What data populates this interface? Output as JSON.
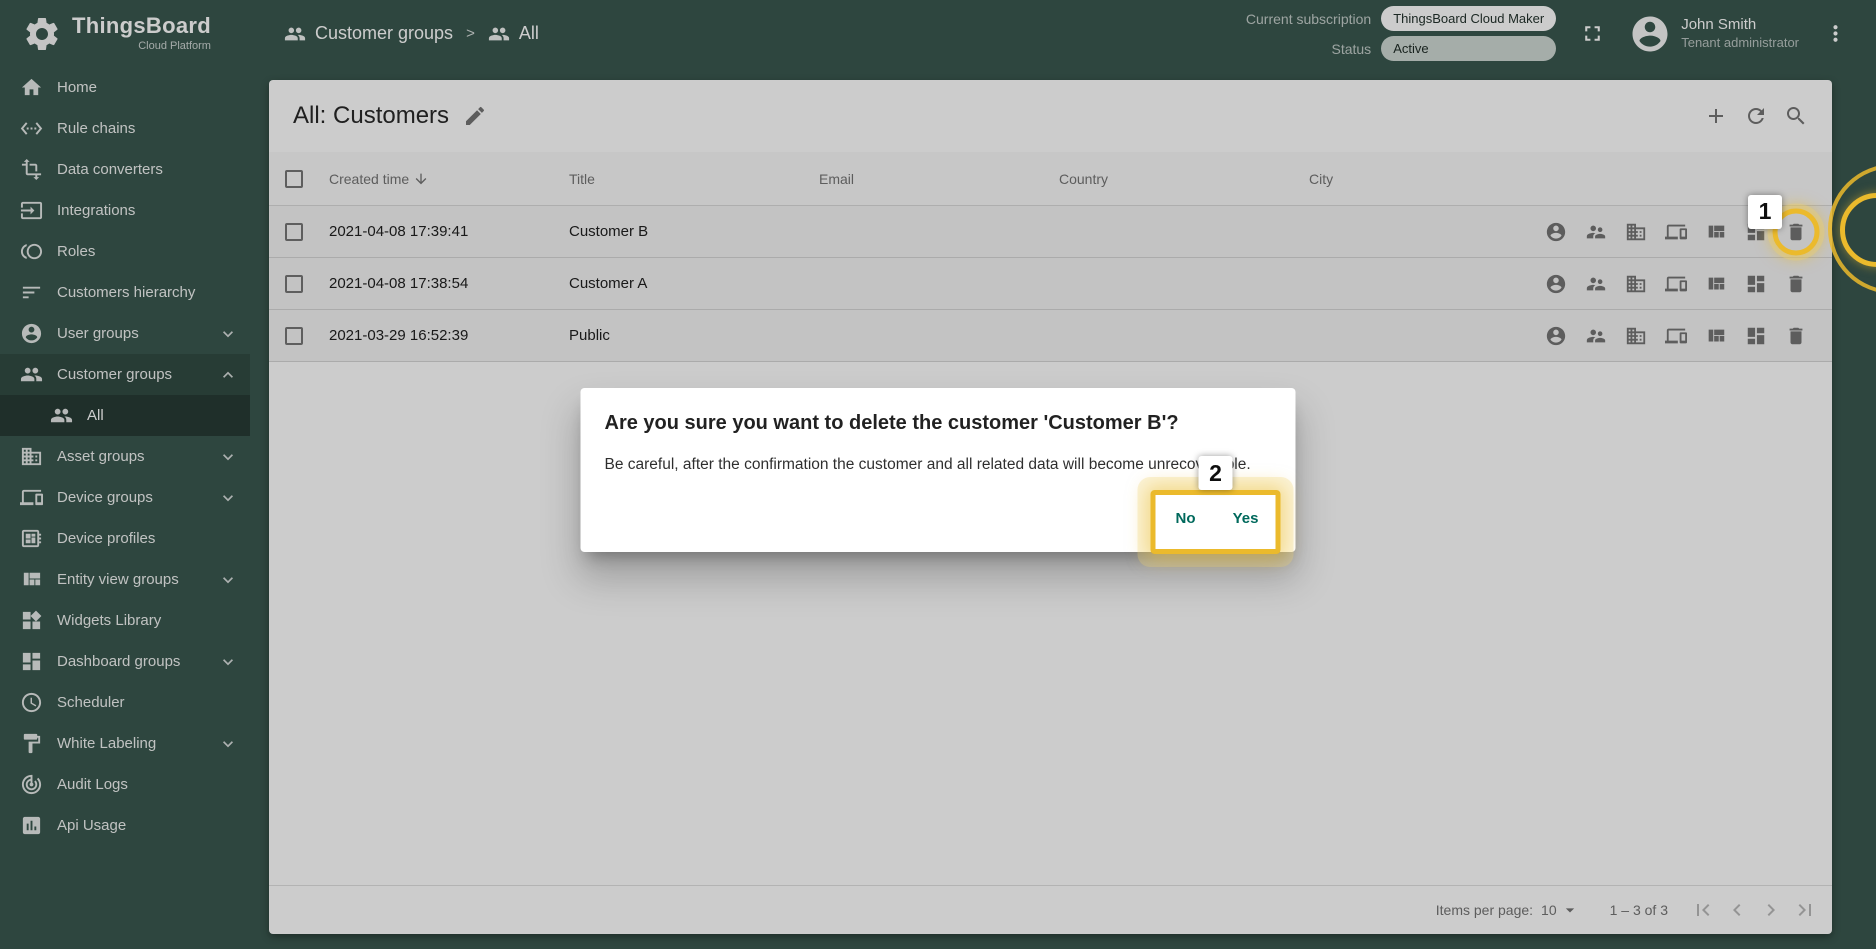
{
  "brand": {
    "name": "ThingsBoard",
    "tagline": "Cloud Platform",
    "logo_icon": "logo-gear-icon"
  },
  "header": {
    "breadcrumb": [
      {
        "label": "Customer groups",
        "icon": "customer-groups-icon"
      },
      {
        "label": "All",
        "icon": "people-icon"
      }
    ],
    "separator": ">",
    "subscription": {
      "label": "Current subscription",
      "value": "ThingsBoard Cloud Maker"
    },
    "status": {
      "label": "Status",
      "value": "Active"
    },
    "user": {
      "name": "John Smith",
      "role": "Tenant administrator"
    }
  },
  "sidebar": {
    "items": [
      {
        "label": "Home",
        "icon": "home-icon"
      },
      {
        "label": "Rule chains",
        "icon": "rule-chains-icon"
      },
      {
        "label": "Data converters",
        "icon": "data-converters-icon"
      },
      {
        "label": "Integrations",
        "icon": "integrations-icon"
      },
      {
        "label": "Roles",
        "icon": "roles-icon"
      },
      {
        "label": "Customers hierarchy",
        "icon": "customers-hierarchy-icon"
      },
      {
        "label": "User groups",
        "icon": "user-groups-icon",
        "expandable": true,
        "expanded": false
      },
      {
        "label": "Customer groups",
        "icon": "customer-groups-icon",
        "expandable": true,
        "expanded": true,
        "section": true
      },
      {
        "label": "All",
        "icon": "people-icon",
        "child": true,
        "section": true,
        "active": true
      },
      {
        "label": "Asset groups",
        "icon": "asset-groups-icon",
        "expandable": true,
        "expanded": false
      },
      {
        "label": "Device groups",
        "icon": "device-groups-icon",
        "expandable": true,
        "expanded": false
      },
      {
        "label": "Device profiles",
        "icon": "device-profiles-icon"
      },
      {
        "label": "Entity view groups",
        "icon": "entity-view-groups-icon",
        "expandable": true,
        "expanded": false
      },
      {
        "label": "Widgets Library",
        "icon": "widgets-icon"
      },
      {
        "label": "Dashboard groups",
        "icon": "dashboard-groups-icon",
        "expandable": true,
        "expanded": false
      },
      {
        "label": "Scheduler",
        "icon": "scheduler-icon"
      },
      {
        "label": "White Labeling",
        "icon": "white-labeling-icon",
        "expandable": true,
        "expanded": false
      },
      {
        "label": "Audit Logs",
        "icon": "audit-logs-icon"
      },
      {
        "label": "Api Usage",
        "icon": "api-usage-icon"
      }
    ]
  },
  "page": {
    "title": "All: Customers"
  },
  "table": {
    "columns": [
      {
        "label": "Created time",
        "sort": "desc"
      },
      {
        "label": "Title"
      },
      {
        "label": "Email"
      },
      {
        "label": "Country"
      },
      {
        "label": "City"
      }
    ],
    "rows": [
      {
        "created_time": "2021-04-08 17:39:41",
        "title": "Customer B",
        "email": "",
        "country": "",
        "city": ""
      },
      {
        "created_time": "2021-04-08 17:38:54",
        "title": "Customer A",
        "email": "",
        "country": "",
        "city": ""
      },
      {
        "created_time": "2021-03-29 16:52:39",
        "title": "Public",
        "email": "",
        "country": "",
        "city": ""
      }
    ],
    "row_actions": [
      {
        "name": "manage-users",
        "icon": "account-circle-icon"
      },
      {
        "name": "manage-user-groups",
        "icon": "supervisor-account-icon"
      },
      {
        "name": "manage-asset-groups",
        "icon": "asset-groups-icon"
      },
      {
        "name": "manage-device-groups",
        "icon": "device-groups-icon"
      },
      {
        "name": "manage-entity-view-groups",
        "icon": "entity-view-groups-icon"
      },
      {
        "name": "manage-dashboard-groups",
        "icon": "dashboard-groups-icon"
      },
      {
        "name": "delete",
        "icon": "delete-icon"
      }
    ]
  },
  "paginator": {
    "items_per_page_label": "Items per page:",
    "items_per_page": "10",
    "range": "1 – 3 of 3"
  },
  "dialog": {
    "title": "Are you sure you want to delete the customer 'Customer B'?",
    "message": "Be careful, after the confirmation the customer and all related data will become unrecoverable.",
    "buttons": {
      "no": "No",
      "yes": "Yes"
    }
  },
  "annotations": {
    "step1": "1",
    "step2": "2"
  },
  "colors": {
    "primary": "#3A584F",
    "button_accent": "#00695C",
    "annotation": "#EBBA2C",
    "status_active_chip": "#cfd9d4"
  }
}
